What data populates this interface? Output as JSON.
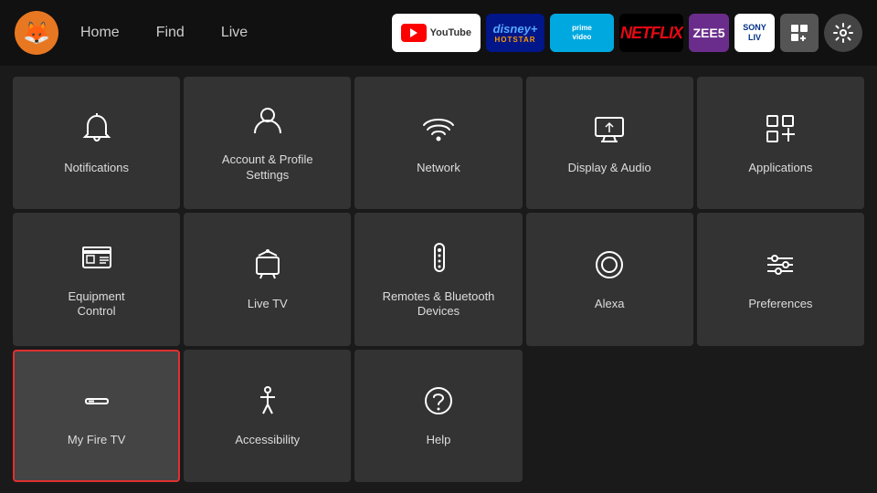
{
  "nav": {
    "logo": "🦊",
    "links": [
      "Home",
      "Find",
      "Live"
    ],
    "apps": [
      {
        "name": "YouTube",
        "type": "youtube"
      },
      {
        "name": "Disney+ Hotstar",
        "type": "disney"
      },
      {
        "name": "Prime Video",
        "type": "prime"
      },
      {
        "name": "Netflix",
        "type": "netflix"
      },
      {
        "name": "Zee5",
        "type": "zee5"
      },
      {
        "name": "SonyLIV",
        "type": "sonyliv"
      }
    ]
  },
  "tiles": [
    {
      "id": "notifications",
      "label": "Notifications",
      "icon": "bell"
    },
    {
      "id": "account",
      "label": "Account & Profile\nSettings",
      "icon": "person"
    },
    {
      "id": "network",
      "label": "Network",
      "icon": "wifi"
    },
    {
      "id": "display-audio",
      "label": "Display & Audio",
      "icon": "display"
    },
    {
      "id": "applications",
      "label": "Applications",
      "icon": "apps"
    },
    {
      "id": "equipment-control",
      "label": "Equipment\nControl",
      "icon": "tv"
    },
    {
      "id": "live-tv",
      "label": "Live TV",
      "icon": "livetv"
    },
    {
      "id": "remotes-bluetooth",
      "label": "Remotes & Bluetooth\nDevices",
      "icon": "remote"
    },
    {
      "id": "alexa",
      "label": "Alexa",
      "icon": "alexa"
    },
    {
      "id": "preferences",
      "label": "Preferences",
      "icon": "sliders"
    },
    {
      "id": "my-fire-tv",
      "label": "My Fire TV",
      "icon": "firetv",
      "selected": true
    },
    {
      "id": "accessibility",
      "label": "Accessibility",
      "icon": "accessibility"
    },
    {
      "id": "help",
      "label": "Help",
      "icon": "help"
    }
  ]
}
